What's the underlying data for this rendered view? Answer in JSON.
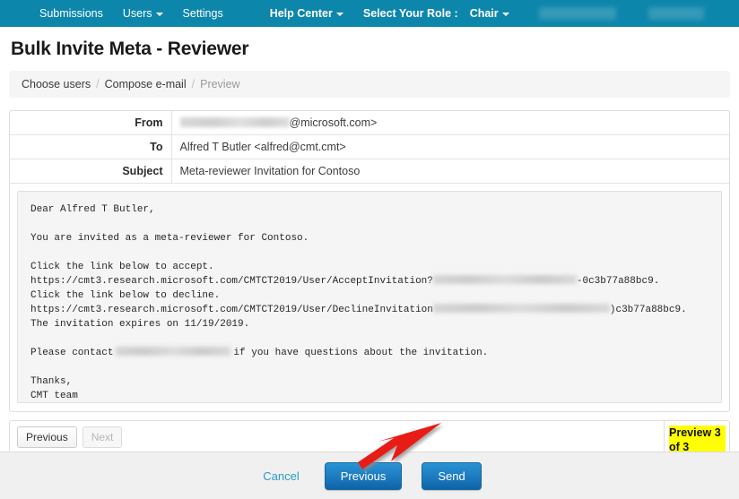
{
  "navbar": {
    "items": [
      {
        "label": "Submissions",
        "has_caret": false,
        "bold": false
      },
      {
        "label": "Users",
        "has_caret": true,
        "bold": false
      },
      {
        "label": "Settings",
        "has_caret": false,
        "bold": false
      }
    ],
    "help_center": "Help Center",
    "role_label": "Select Your Role :",
    "role_value": "Chair",
    "redacted_items": [
      "",
      ""
    ],
    "background_color": "#0d86ab"
  },
  "page": {
    "title": "Bulk Invite Meta - Reviewer"
  },
  "breadcrumb": {
    "separator": "/",
    "steps": [
      {
        "label": "Choose users",
        "active": false
      },
      {
        "label": "Compose e-mail",
        "active": false
      },
      {
        "label": "Preview",
        "active": true
      }
    ]
  },
  "mail": {
    "from_label": "From",
    "from_value_suffix": "@microsoft.com>",
    "to_label": "To",
    "to_value": "Alfred T Butler <alfred@cmt.cmt>",
    "subject_label": "Subject",
    "subject_value": "Meta-reviewer Invitation for Contoso",
    "body": {
      "greeting": "Dear Alfred T Butler,",
      "intro": "You are invited as a meta-reviewer for Contoso.",
      "accept_prompt": "Click the link below to accept.",
      "accept_url_prefix": "https://cmt3.research.microsoft.com/CMTCT2019/User/AcceptInvitation?",
      "accept_url_suffix": "-0c3b77a88bc9.",
      "decline_prompt": "Click the link below to decline.",
      "decline_url_prefix": "https://cmt3.research.microsoft.com/CMTCT2019/User/DeclineInvitation",
      "decline_url_suffix": ")c3b77a88bc9.",
      "expiry": "The invitation expires on 11/19/2019.",
      "contact_prefix": "Please contact",
      "contact_suffix": "if you have questions about the invitation.",
      "signoff": "Thanks,",
      "team": "CMT team"
    }
  },
  "pager": {
    "previous_label": "Previous",
    "next_label": "Next",
    "next_disabled": true,
    "preview_count": "Preview 3 of 3",
    "highlight_color": "#ffff00"
  },
  "footer": {
    "cancel_label": "Cancel",
    "previous_label": "Previous",
    "send_label": "Send",
    "primary_color": "#1f7fc2",
    "link_color": "#2b9bc4"
  },
  "annotation": {
    "arrow_color": "#e81c16",
    "points_to": "Send"
  }
}
